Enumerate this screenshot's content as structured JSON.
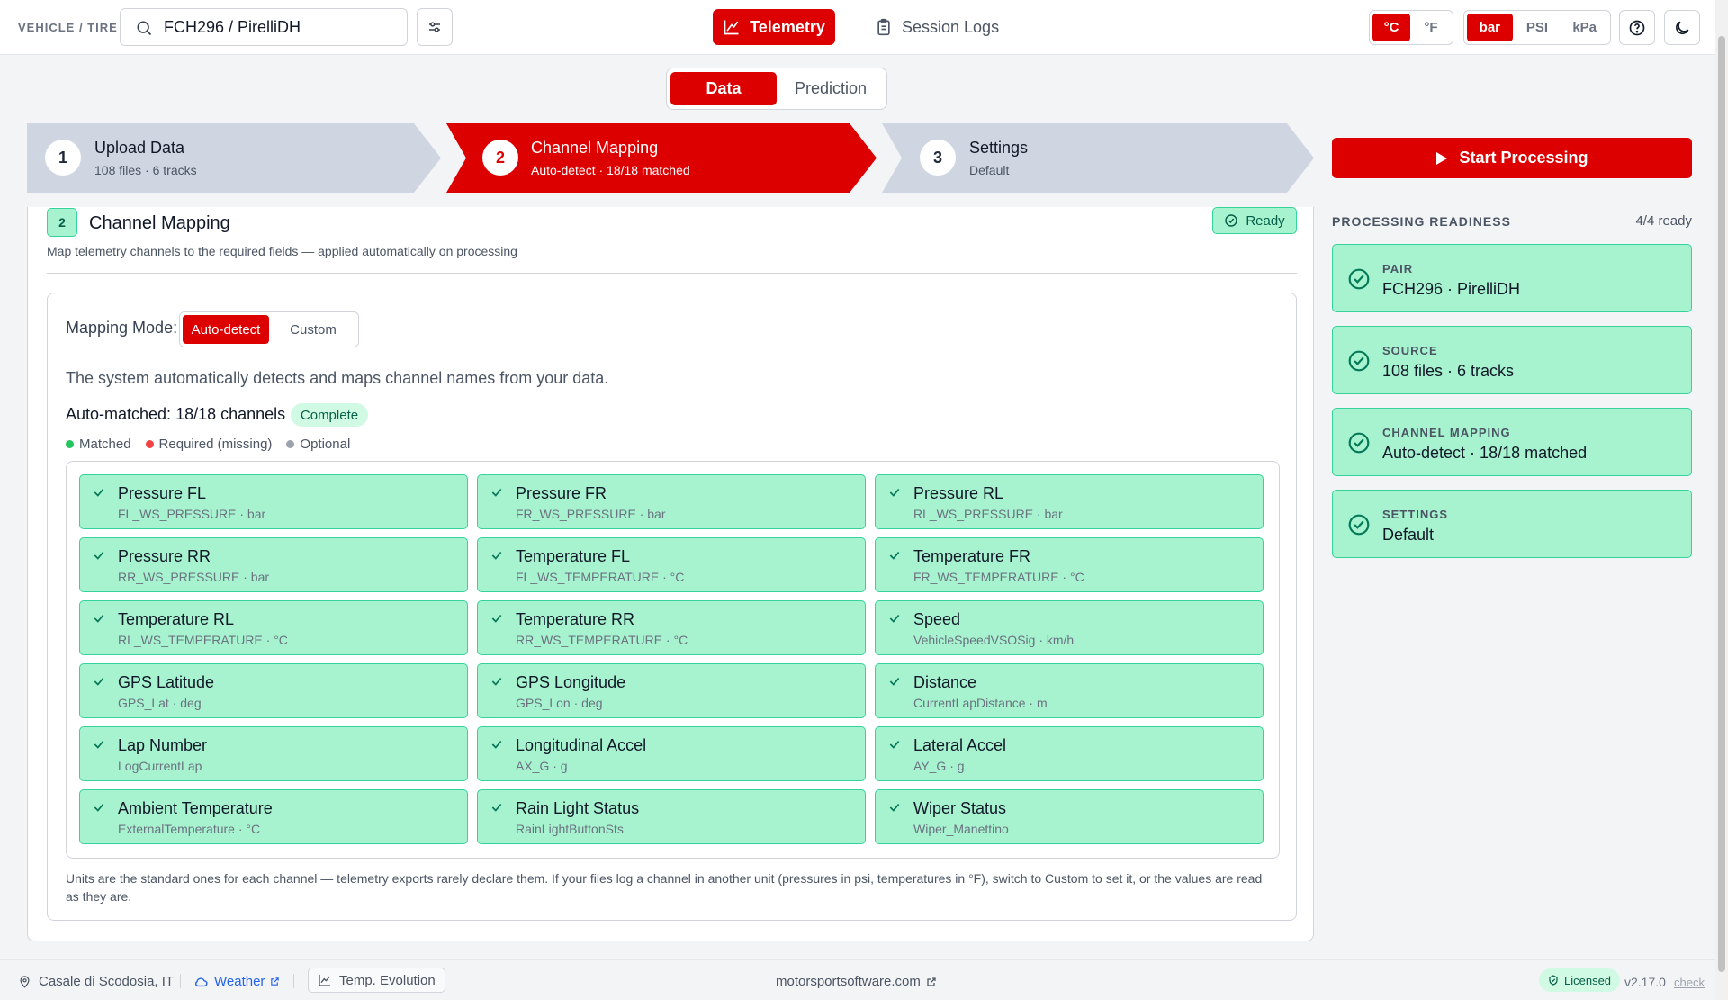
{
  "header": {
    "vehicle_tire_label": "VEHICLE / TIRE",
    "search_value": "FCH296 / PirelliDH",
    "nav_telemetry": "Telemetry",
    "nav_session_logs": "Session Logs",
    "temp_units": [
      "°C",
      "°F"
    ],
    "temp_selected": "°C",
    "pressure_units": [
      "bar",
      "PSI",
      "kPa"
    ],
    "pressure_selected": "bar"
  },
  "tabs": {
    "data": "Data",
    "prediction": "Prediction",
    "active": "Data"
  },
  "stepper": [
    {
      "number": "1",
      "title": "Upload Data",
      "subtitle": "108 files · 6 tracks",
      "state": "done"
    },
    {
      "number": "2",
      "title": "Channel Mapping",
      "subtitle": "Auto-detect · 18/18 matched",
      "state": "active"
    },
    {
      "number": "3",
      "title": "Settings",
      "subtitle": "Default",
      "state": "done"
    }
  ],
  "start_button": "Start Processing",
  "channel_mapping": {
    "step_number": "2",
    "title": "Channel Mapping",
    "subtitle": "Map telemetry channels to the required fields — applied automatically on processing",
    "ready_badge": "Ready",
    "mode_label": "Mapping Mode:",
    "modes": [
      "Auto-detect",
      "Custom"
    ],
    "mode_selected": "Auto-detect",
    "description": "The system automatically detects and maps channel names from your data.",
    "auto_matched": "Auto-matched: 18/18 channels",
    "complete_badge": "Complete",
    "legend": [
      {
        "label": "Matched",
        "color": "#22c55e"
      },
      {
        "label": "Required (missing)",
        "color": "#ef4444"
      },
      {
        "label": "Optional",
        "color": "#9ca3af"
      }
    ],
    "channels": [
      {
        "name": "Pressure FL",
        "detail": "FL_WS_PRESSURE · bar"
      },
      {
        "name": "Pressure FR",
        "detail": "FR_WS_PRESSURE · bar"
      },
      {
        "name": "Pressure RL",
        "detail": "RL_WS_PRESSURE · bar"
      },
      {
        "name": "Pressure RR",
        "detail": "RR_WS_PRESSURE · bar"
      },
      {
        "name": "Temperature FL",
        "detail": "FL_WS_TEMPERATURE · °C"
      },
      {
        "name": "Temperature FR",
        "detail": "FR_WS_TEMPERATURE · °C"
      },
      {
        "name": "Temperature RL",
        "detail": "RL_WS_TEMPERATURE · °C"
      },
      {
        "name": "Temperature RR",
        "detail": "RR_WS_TEMPERATURE · °C"
      },
      {
        "name": "Speed",
        "detail": "VehicleSpeedVSOSig · km/h"
      },
      {
        "name": "GPS Latitude",
        "detail": "GPS_Lat · deg"
      },
      {
        "name": "GPS Longitude",
        "detail": "GPS_Lon · deg"
      },
      {
        "name": "Distance",
        "detail": "CurrentLapDistance · m"
      },
      {
        "name": "Lap Number",
        "detail": "LogCurrentLap"
      },
      {
        "name": "Longitudinal Accel",
        "detail": "AX_G · g"
      },
      {
        "name": "Lateral Accel",
        "detail": "AY_G · g"
      },
      {
        "name": "Ambient Temperature",
        "detail": "ExternalTemperature · °C"
      },
      {
        "name": "Rain Light Status",
        "detail": "RainLightButtonSts"
      },
      {
        "name": "Wiper Status",
        "detail": "Wiper_Manettino"
      }
    ],
    "units_note": "Units are the standard ones for each channel — telemetry exports rarely declare them. If your files log a channel in another unit (pressures in psi, temperatures in °F), switch to Custom to set it, or the values are read as they are."
  },
  "readiness": {
    "title": "PROCESSING READINESS",
    "count": "4/4 ready",
    "items": [
      {
        "label": "PAIR",
        "value": "FCH296 · PirelliDH"
      },
      {
        "label": "SOURCE",
        "value": "108 files · 6 tracks"
      },
      {
        "label": "CHANNEL MAPPING",
        "value": "Auto-detect · 18/18 matched"
      },
      {
        "label": "SETTINGS",
        "value": "Default"
      }
    ]
  },
  "footer": {
    "location": "Casale di Scodosia, IT",
    "weather": "Weather",
    "temp_evolution": "Temp. Evolution",
    "site": "motorsportsoftware.com",
    "license": "Licensed",
    "version": "v2.17.0",
    "check": "check"
  },
  "colors": {
    "accent": "#dc0000",
    "success_bg": "#a7f3d0",
    "success_border": "#34d399"
  }
}
